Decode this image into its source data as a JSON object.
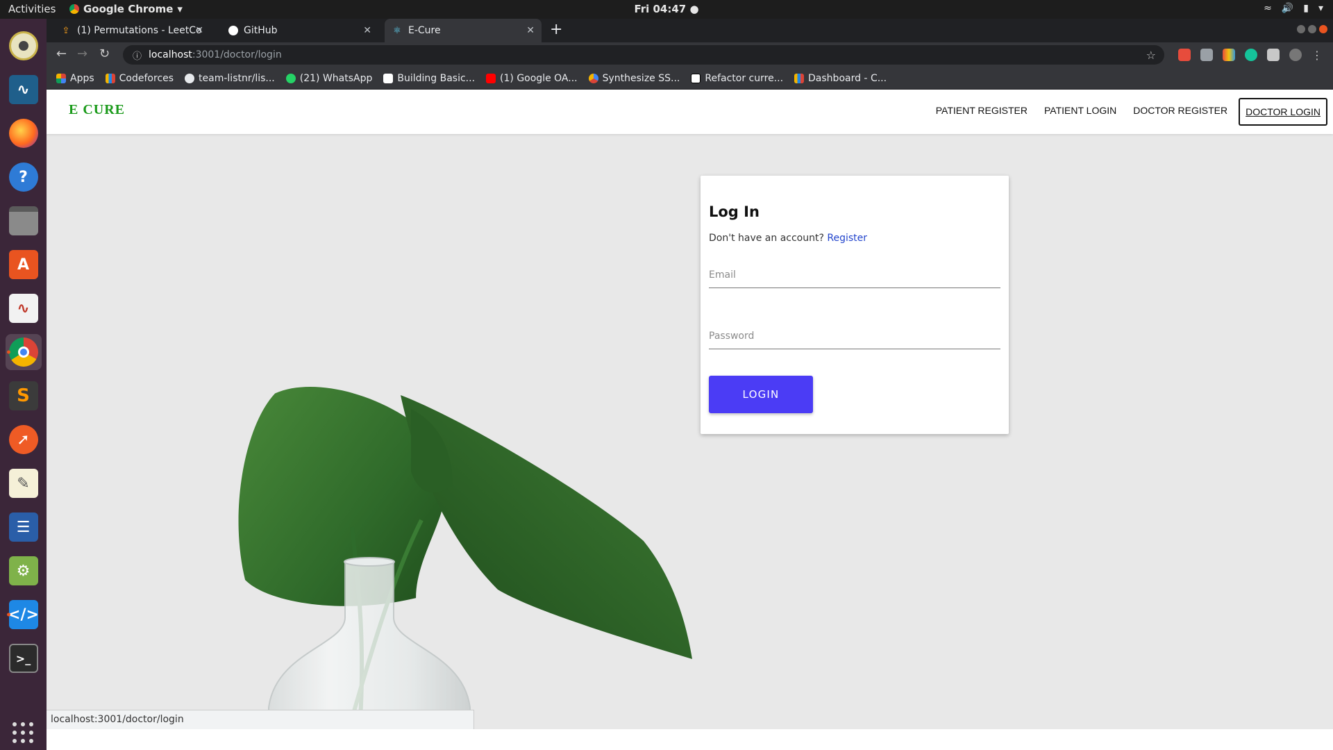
{
  "os": {
    "activities": "Activities",
    "app_name": "Google Chrome",
    "clock": "Fri 04:47 ●"
  },
  "dock": {
    "items": [
      "rhythmbox-icon",
      "mysql-workbench-icon",
      "firefox-icon",
      "help-icon",
      "file-manager-icon",
      "software-center-icon",
      "document-viewer-icon",
      "chrome-icon",
      "sublime-text-icon",
      "postman-icon",
      "text-editor-icon",
      "libreoffice-writer-icon",
      "image-viewer-icon",
      "vscode-icon",
      "terminal-icon"
    ]
  },
  "browser": {
    "tabs": [
      {
        "title": "(1) Permutations - LeetCo"
      },
      {
        "title": "GitHub"
      },
      {
        "title": "E-Cure"
      }
    ],
    "url_host": "localhost",
    "url_path": ":3001/doctor/login",
    "bookmarks": [
      {
        "label": "Apps"
      },
      {
        "label": "Codeforces"
      },
      {
        "label": "team-listnr/lis..."
      },
      {
        "label": "(21) WhatsApp"
      },
      {
        "label": "Building Basic..."
      },
      {
        "label": "(1) Google OA..."
      },
      {
        "label": "Synthesize SS..."
      },
      {
        "label": "Refactor curre..."
      },
      {
        "label": "Dashboard - C..."
      }
    ],
    "status_url": "localhost:3001/doctor/login"
  },
  "app": {
    "brand": "E CURE",
    "nav": [
      {
        "label": "PATIENT REGISTER"
      },
      {
        "label": "PATIENT LOGIN"
      },
      {
        "label": "DOCTOR REGISTER"
      },
      {
        "label": "DOCTOR LOGIN"
      }
    ],
    "login": {
      "title": "Log In",
      "no_account": "Don't have an account?",
      "register_link": "Register",
      "email_placeholder": "Email",
      "password_placeholder": "Password",
      "submit": "LOGIN"
    }
  },
  "colors": {
    "brand_green": "#1a9a1a",
    "button_purple": "#4b3cf5",
    "link_blue": "#2244cc",
    "page_bg": "#e8e8e8"
  }
}
